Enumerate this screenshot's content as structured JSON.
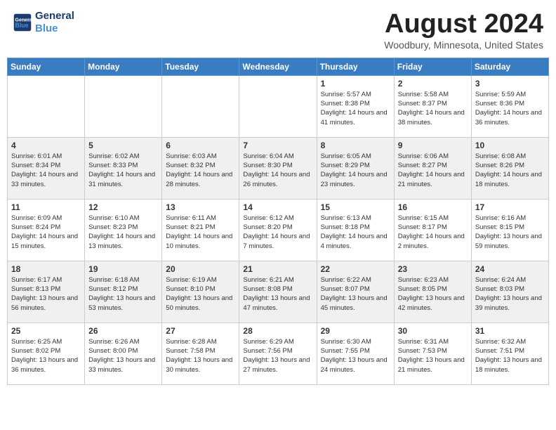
{
  "header": {
    "logo_line1": "General",
    "logo_line2": "Blue",
    "month_year": "August 2024",
    "location": "Woodbury, Minnesota, United States"
  },
  "weekdays": [
    "Sunday",
    "Monday",
    "Tuesday",
    "Wednesday",
    "Thursday",
    "Friday",
    "Saturday"
  ],
  "weeks": [
    [
      {
        "day": "",
        "info": ""
      },
      {
        "day": "",
        "info": ""
      },
      {
        "day": "",
        "info": ""
      },
      {
        "day": "",
        "info": ""
      },
      {
        "day": "1",
        "info": "Sunrise: 5:57 AM\nSunset: 8:38 PM\nDaylight: 14 hours\nand 41 minutes."
      },
      {
        "day": "2",
        "info": "Sunrise: 5:58 AM\nSunset: 8:37 PM\nDaylight: 14 hours\nand 38 minutes."
      },
      {
        "day": "3",
        "info": "Sunrise: 5:59 AM\nSunset: 8:36 PM\nDaylight: 14 hours\nand 36 minutes."
      }
    ],
    [
      {
        "day": "4",
        "info": "Sunrise: 6:01 AM\nSunset: 8:34 PM\nDaylight: 14 hours\nand 33 minutes."
      },
      {
        "day": "5",
        "info": "Sunrise: 6:02 AM\nSunset: 8:33 PM\nDaylight: 14 hours\nand 31 minutes."
      },
      {
        "day": "6",
        "info": "Sunrise: 6:03 AM\nSunset: 8:32 PM\nDaylight: 14 hours\nand 28 minutes."
      },
      {
        "day": "7",
        "info": "Sunrise: 6:04 AM\nSunset: 8:30 PM\nDaylight: 14 hours\nand 26 minutes."
      },
      {
        "day": "8",
        "info": "Sunrise: 6:05 AM\nSunset: 8:29 PM\nDaylight: 14 hours\nand 23 minutes."
      },
      {
        "day": "9",
        "info": "Sunrise: 6:06 AM\nSunset: 8:27 PM\nDaylight: 14 hours\nand 21 minutes."
      },
      {
        "day": "10",
        "info": "Sunrise: 6:08 AM\nSunset: 8:26 PM\nDaylight: 14 hours\nand 18 minutes."
      }
    ],
    [
      {
        "day": "11",
        "info": "Sunrise: 6:09 AM\nSunset: 8:24 PM\nDaylight: 14 hours\nand 15 minutes."
      },
      {
        "day": "12",
        "info": "Sunrise: 6:10 AM\nSunset: 8:23 PM\nDaylight: 14 hours\nand 13 minutes."
      },
      {
        "day": "13",
        "info": "Sunrise: 6:11 AM\nSunset: 8:21 PM\nDaylight: 14 hours\nand 10 minutes."
      },
      {
        "day": "14",
        "info": "Sunrise: 6:12 AM\nSunset: 8:20 PM\nDaylight: 14 hours\nand 7 minutes."
      },
      {
        "day": "15",
        "info": "Sunrise: 6:13 AM\nSunset: 8:18 PM\nDaylight: 14 hours\nand 4 minutes."
      },
      {
        "day": "16",
        "info": "Sunrise: 6:15 AM\nSunset: 8:17 PM\nDaylight: 14 hours\nand 2 minutes."
      },
      {
        "day": "17",
        "info": "Sunrise: 6:16 AM\nSunset: 8:15 PM\nDaylight: 13 hours\nand 59 minutes."
      }
    ],
    [
      {
        "day": "18",
        "info": "Sunrise: 6:17 AM\nSunset: 8:13 PM\nDaylight: 13 hours\nand 56 minutes."
      },
      {
        "day": "19",
        "info": "Sunrise: 6:18 AM\nSunset: 8:12 PM\nDaylight: 13 hours\nand 53 minutes."
      },
      {
        "day": "20",
        "info": "Sunrise: 6:19 AM\nSunset: 8:10 PM\nDaylight: 13 hours\nand 50 minutes."
      },
      {
        "day": "21",
        "info": "Sunrise: 6:21 AM\nSunset: 8:08 PM\nDaylight: 13 hours\nand 47 minutes."
      },
      {
        "day": "22",
        "info": "Sunrise: 6:22 AM\nSunset: 8:07 PM\nDaylight: 13 hours\nand 45 minutes."
      },
      {
        "day": "23",
        "info": "Sunrise: 6:23 AM\nSunset: 8:05 PM\nDaylight: 13 hours\nand 42 minutes."
      },
      {
        "day": "24",
        "info": "Sunrise: 6:24 AM\nSunset: 8:03 PM\nDaylight: 13 hours\nand 39 minutes."
      }
    ],
    [
      {
        "day": "25",
        "info": "Sunrise: 6:25 AM\nSunset: 8:02 PM\nDaylight: 13 hours\nand 36 minutes."
      },
      {
        "day": "26",
        "info": "Sunrise: 6:26 AM\nSunset: 8:00 PM\nDaylight: 13 hours\nand 33 minutes."
      },
      {
        "day": "27",
        "info": "Sunrise: 6:28 AM\nSunset: 7:58 PM\nDaylight: 13 hours\nand 30 minutes."
      },
      {
        "day": "28",
        "info": "Sunrise: 6:29 AM\nSunset: 7:56 PM\nDaylight: 13 hours\nand 27 minutes."
      },
      {
        "day": "29",
        "info": "Sunrise: 6:30 AM\nSunset: 7:55 PM\nDaylight: 13 hours\nand 24 minutes."
      },
      {
        "day": "30",
        "info": "Sunrise: 6:31 AM\nSunset: 7:53 PM\nDaylight: 13 hours\nand 21 minutes."
      },
      {
        "day": "31",
        "info": "Sunrise: 6:32 AM\nSunset: 7:51 PM\nDaylight: 13 hours\nand 18 minutes."
      }
    ]
  ]
}
